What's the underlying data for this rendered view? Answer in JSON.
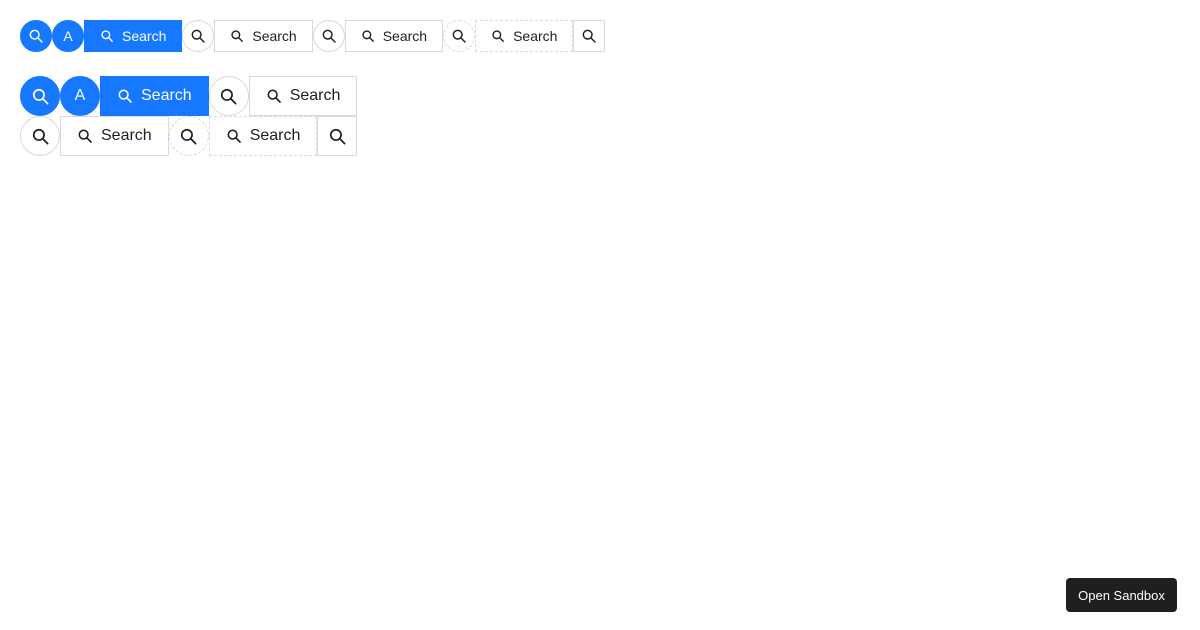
{
  "colors": {
    "primary": "#1677ff",
    "border": "#d9d9d9",
    "text": "#1f1f1f",
    "sandbox_bg": "#1f1f1f",
    "white": "#ffffff"
  },
  "icons": {
    "search": "search-icon"
  },
  "row_small": {
    "primary_letter": "A",
    "primary_label": "Search",
    "default_label": "Search",
    "default_label_2": "Search",
    "dashed_label": "Search"
  },
  "row_large_a": {
    "primary_letter": "A",
    "primary_label": "Search",
    "default_label": "Search"
  },
  "row_large_b": {
    "default_label": "Search",
    "dashed_label": "Search"
  },
  "sandbox": {
    "label": "Open Sandbox"
  }
}
